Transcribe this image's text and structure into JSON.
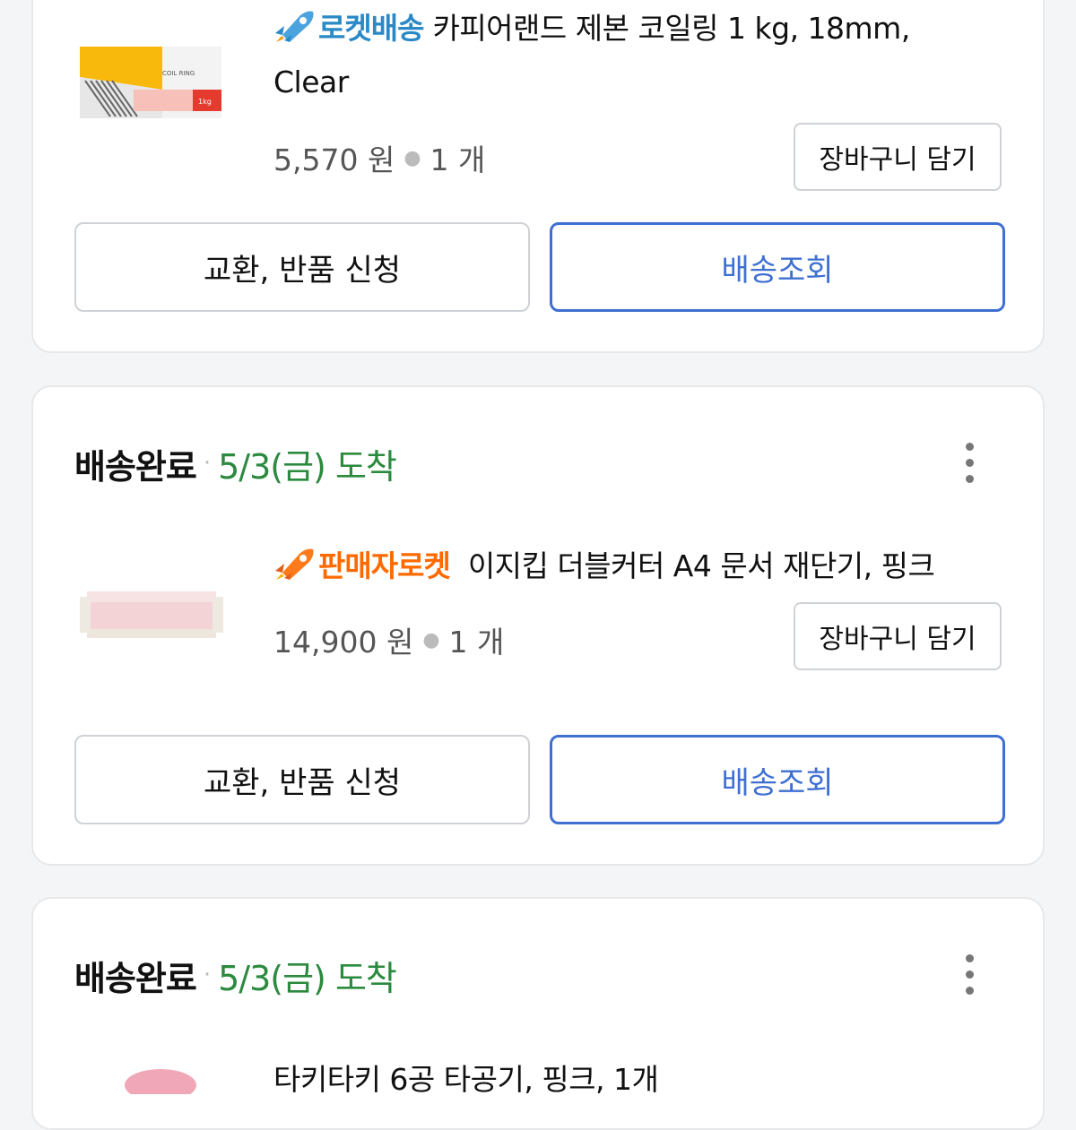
{
  "colors": {
    "status_date": "#2b8a3e",
    "rocket_badge": "#2a89c6",
    "seller_badge": "#ff6a00",
    "track_button": "#3e6fd1"
  },
  "order1": {
    "badge": "로켓배송",
    "name_line1": "카피어랜드 제본 코일링 1 kg, 18mm,",
    "name_line2": "Clear",
    "price": "5,570 원",
    "qty": "1 개",
    "cart_label": "장바구니 담기",
    "exchange_label": "교환, 반품 신청",
    "track_label": "배송조회",
    "thumb_text": "COIL RING",
    "thumb_weight": "1kg"
  },
  "order2": {
    "status": "배송완료",
    "date": "5/3(금) 도착",
    "badge": "판매자로켓",
    "name": "이지킵 더블커터 A4 문서 재단기, 핑크",
    "price": "14,900 원",
    "qty": "1 개",
    "cart_label": "장바구니 담기",
    "exchange_label": "교환, 반품 신청",
    "track_label": "배송조회"
  },
  "order3": {
    "status": "배송완료",
    "date": "5/3(금) 도착",
    "name_partial": "타키타키 6공 타공기, 핑크, 1개"
  }
}
